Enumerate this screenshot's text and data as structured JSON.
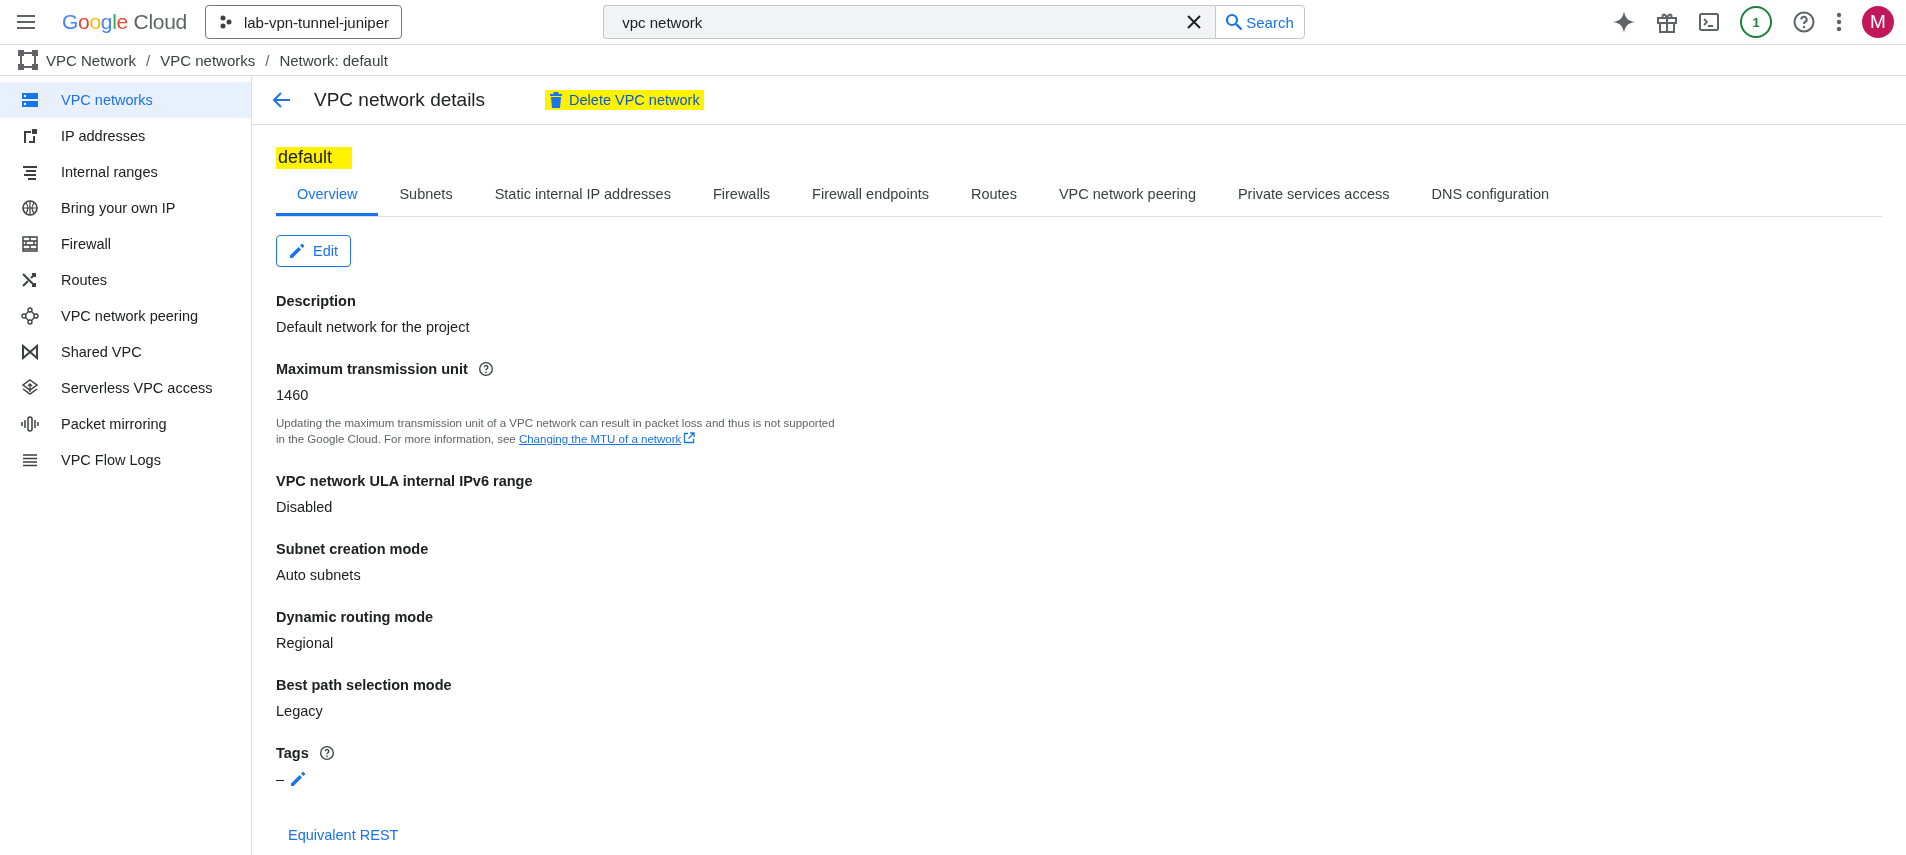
{
  "topbar": {
    "logo": {
      "word": "Google",
      "product": "Cloud"
    },
    "project": "lab-vpn-tunnel-juniper",
    "search": {
      "value": "vpc network",
      "button": "Search"
    },
    "notifications": "1",
    "avatar": "M"
  },
  "breadcrumb": [
    {
      "kind": "link",
      "text": "VPC Network"
    },
    {
      "kind": "separator",
      "text": "/"
    },
    {
      "kind": "link",
      "text": "VPC networks"
    },
    {
      "kind": "separator",
      "text": "/"
    },
    {
      "kind": "link",
      "text": "Network: default"
    }
  ],
  "sidebar": {
    "items": [
      {
        "label": "VPC networks",
        "selected": true
      },
      {
        "label": "IP addresses",
        "selected": false
      },
      {
        "label": "Internal ranges",
        "selected": false
      },
      {
        "label": "Bring your own IP",
        "selected": false
      },
      {
        "label": "Firewall",
        "selected": false
      },
      {
        "label": "Routes",
        "selected": false
      },
      {
        "label": "VPC network peering",
        "selected": false
      },
      {
        "label": "Shared VPC",
        "selected": false
      },
      {
        "label": "Serverless VPC access",
        "selected": false
      },
      {
        "label": "Packet mirroring",
        "selected": false
      },
      {
        "label": "VPC Flow Logs",
        "selected": false
      }
    ]
  },
  "header": {
    "title": "VPC network details",
    "delete_action": {
      "label": "Delete VPC network",
      "highlighted": true
    }
  },
  "network": {
    "name": "default",
    "highlighted": true
  },
  "tabs": [
    {
      "label": "Overview",
      "selected": true
    },
    {
      "label": "Subnets",
      "selected": false
    },
    {
      "label": "Static internal IP addresses",
      "selected": false
    },
    {
      "label": "Firewalls",
      "selected": false
    },
    {
      "label": "Firewall endpoints",
      "selected": false
    },
    {
      "label": "Routes",
      "selected": false
    },
    {
      "label": "VPC network peering",
      "selected": false
    },
    {
      "label": "Private services access",
      "selected": false
    },
    {
      "label": "DNS configuration",
      "selected": false
    }
  ],
  "edit_button": "Edit",
  "fields": [
    {
      "kind": "text",
      "label": "Description",
      "help": false,
      "value": "Default network for the project"
    },
    {
      "kind": "text",
      "label": "Maximum transmission unit",
      "help": true,
      "value": "1460",
      "note": "Updating the maximum transmission unit of a VPC network can result in packet loss and thus is not supported in the Google Cloud. For more information, see ",
      "note_link": "Changing the MTU of a network"
    },
    {
      "kind": "text",
      "label": "VPC network ULA internal IPv6 range",
      "help": false,
      "value": "Disabled"
    },
    {
      "kind": "text",
      "label": "Subnet creation mode",
      "help": false,
      "value": "Auto subnets"
    },
    {
      "kind": "text",
      "label": "Dynamic routing mode",
      "help": false,
      "value": "Regional"
    },
    {
      "kind": "text",
      "label": "Best path selection mode",
      "help": false,
      "value": "Legacy"
    },
    {
      "kind": "tags",
      "label": "Tags",
      "help": true,
      "value": "–"
    }
  ],
  "equivalent_rest": "Equivalent REST"
}
